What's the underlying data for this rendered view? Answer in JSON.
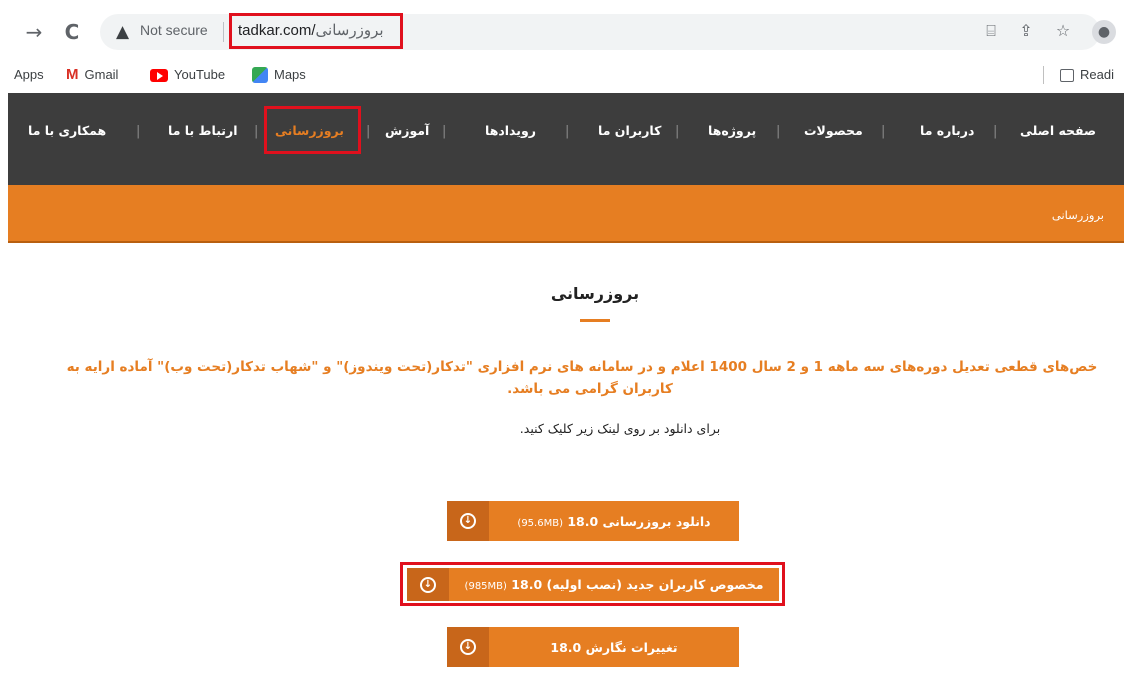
{
  "browser": {
    "back_icon": "→",
    "reload_icon": "C",
    "security_icon": "▲",
    "security_label": "Not secure",
    "url_domain": "tadkar.com/",
    "url_path": "بروزرسانی",
    "bookmarks": [
      {
        "label": "Apps",
        "icon": "apps-icon"
      },
      {
        "label": "Gmail",
        "icon": "gmail-icon"
      },
      {
        "label": "YouTube",
        "icon": "youtube-icon"
      },
      {
        "label": "Maps",
        "icon": "maps-icon"
      }
    ],
    "reading_label": "Readi"
  },
  "site_nav": {
    "items": [
      {
        "label": "صفحه اصلی"
      },
      {
        "label": "درباره ما"
      },
      {
        "label": "محصولات"
      },
      {
        "label": "پروژه‌ها"
      },
      {
        "label": "کاربران ما"
      },
      {
        "label": "رویدادها"
      },
      {
        "label": "آموزش"
      },
      {
        "label": "بروزرسانی",
        "active": true
      },
      {
        "label": "ارتباط با ما"
      },
      {
        "label": "همکاری با ما"
      }
    ],
    "accent_color": "#e67e22"
  },
  "breadcrumb": "بروزرسانی",
  "main": {
    "title": "بروزرسانی",
    "announcement_line1": "خص‌های قطعی تعدیل دوره‌های سه ماهه 1 و 2 سال 1400 اعلام و در سامانه های نرم افزاری \"تدکار(تحت ویندوز)\" و \"شهاب تدکار(تحت وب)\" آماده ارایه به",
    "announcement_line2": "کاربران گرامی می باشد.",
    "instruction": "برای دانلود بر روی لینک زیر کلیک کنید.",
    "buttons": [
      {
        "label": "دانلود بروزرسانی 18.0",
        "size": "(95.6MB)"
      },
      {
        "label": "مخصوص کاربران جدید (نصب اولیه) 18.0",
        "size": "(985MB)"
      },
      {
        "label": "تغییرات نگارش 18.0",
        "size": ""
      }
    ]
  }
}
